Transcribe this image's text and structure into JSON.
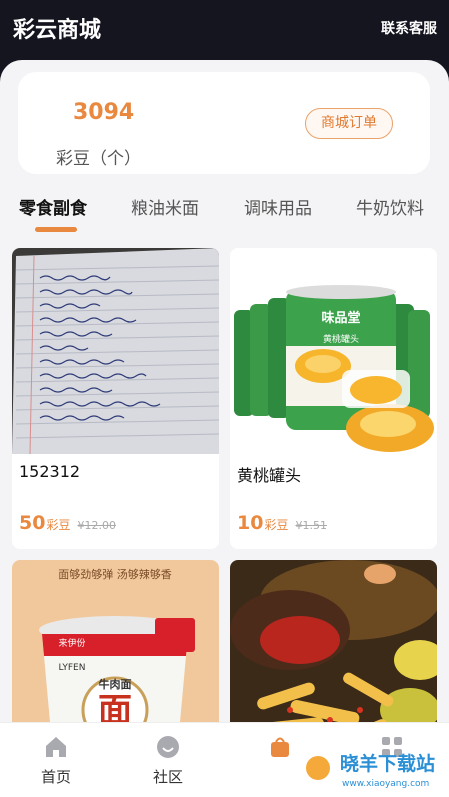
{
  "header": {
    "title": "彩云商城",
    "contact_label": "联系客服"
  },
  "points": {
    "value": "3094",
    "unit_label": "彩豆（个）",
    "orders_button": "商城订单"
  },
  "tabs": [
    {
      "label": "零食副食",
      "active": true
    },
    {
      "label": "粮油米面",
      "active": false
    },
    {
      "label": "调味用品",
      "active": false
    },
    {
      "label": "牛奶饮料",
      "active": false
    }
  ],
  "products": [
    {
      "name": "152312",
      "price": "50",
      "unit": "彩豆",
      "old_price": "¥12.00",
      "image": "handwritten-notebook-photo"
    },
    {
      "name": "黄桃罐头",
      "price": "10",
      "unit": "彩豆",
      "old_price": "¥1.51",
      "image": "canned-peach-photo",
      "image_text": {
        "brand": "味品堂",
        "label": "黄桃罐头"
      }
    },
    {
      "name": "",
      "image": "instant-noodle-cup-photo",
      "image_text": {
        "top": "面够劲够弹 汤够辣够香",
        "brand": "来伊份",
        "brand_en": "LYFEN",
        "flavor": "牛肉面",
        "char": "面"
      }
    },
    {
      "name": "",
      "image": "spicy-snack-photo"
    }
  ],
  "bottom_nav": [
    {
      "label": "首页",
      "icon": "home-icon"
    },
    {
      "label": "社区",
      "icon": "smile-icon"
    },
    {
      "label": "",
      "icon": "mall-icon"
    },
    {
      "label": "",
      "icon": "grid-icon"
    }
  ],
  "watermark": {
    "text": "晓羊下载站",
    "site": "www.xiaoyang.com"
  },
  "colors": {
    "accent": "#e9883f",
    "header_bg": "#14151f",
    "page_bg": "#f4f4f6"
  }
}
